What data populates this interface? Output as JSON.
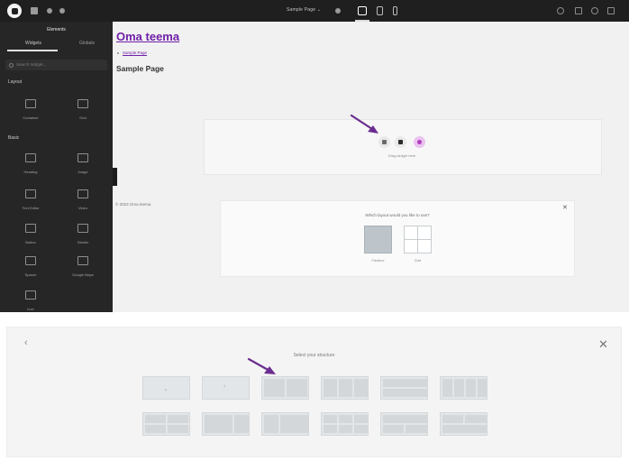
{
  "editor": {
    "topbar": {
      "page_title": "Sample Page ⌄",
      "icons": [
        "elementor-logo-icon",
        "structure-icon",
        "add-icon",
        "settings-icon",
        "desktop-icon",
        "tablet-icon",
        "mobile-icon",
        "finder-icon",
        "history-icon",
        "preview-icon",
        "publish-icon"
      ]
    },
    "sidebar": {
      "header": "Elements",
      "tabs": [
        {
          "label": "Widgets"
        },
        {
          "label": "Globals"
        }
      ],
      "search_placeholder": "Search Widget...",
      "sections": [
        {
          "label": "Layout"
        },
        {
          "label": "Basic"
        }
      ],
      "layout_widgets": [
        {
          "label": "Container"
        },
        {
          "label": "Grid"
        }
      ],
      "basic_widgets": [
        {
          "label": "Heading"
        },
        {
          "label": "Image"
        },
        {
          "label": "Text Editor"
        },
        {
          "label": "Video"
        },
        {
          "label": "Button"
        },
        {
          "label": "Divider"
        },
        {
          "label": "Spacer"
        },
        {
          "label": "Google Maps"
        },
        {
          "label": "Icon"
        }
      ]
    },
    "canvas": {
      "site_title": "Oma teema",
      "breadcrumb_link": "Sample Page",
      "page_heading": "Sample Page",
      "drop_label": "Drag widget here",
      "footer_text": "© 2023 Oma teema",
      "layout_prompt": {
        "question": "Which layout would you like to use?",
        "options": [
          {
            "label": "Flexbox"
          },
          {
            "label": "Grid"
          }
        ]
      }
    },
    "accent_color": "#b03fc0"
  },
  "structure_picker": {
    "title": "Select your structure",
    "back_icon": "chevron-left-icon",
    "close_icon": "close-icon"
  }
}
